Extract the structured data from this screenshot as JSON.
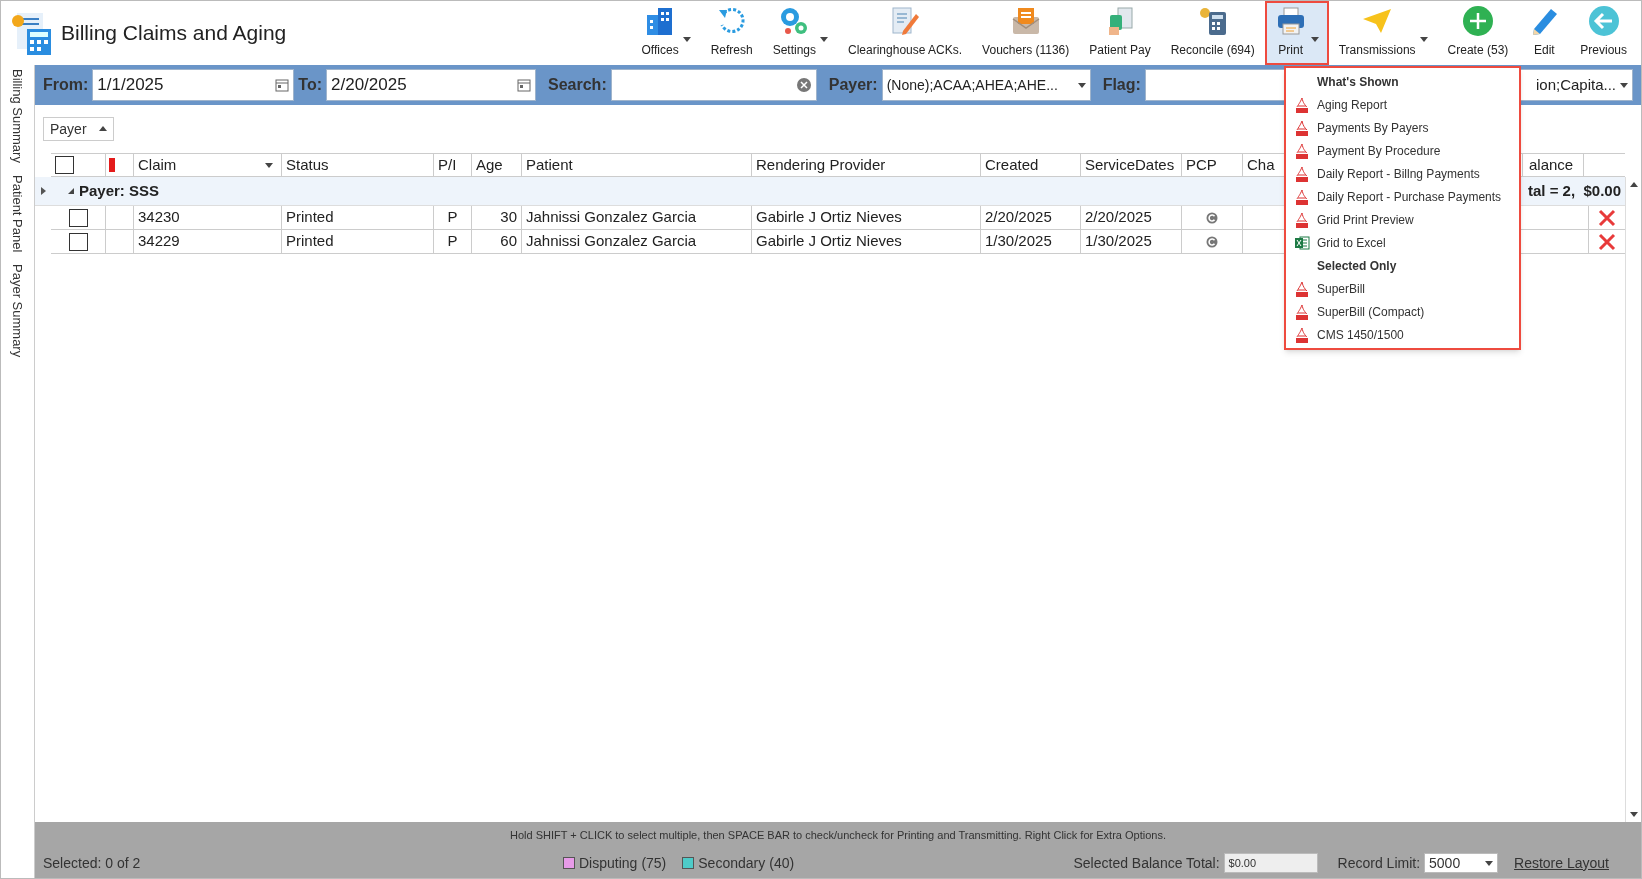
{
  "window": {
    "title": "Billing Claims and Aging"
  },
  "toolbar": [
    {
      "kind": "offices",
      "label": "Offices",
      "dropdown": true,
      "selected": false
    },
    {
      "kind": "refresh",
      "label": "Refresh",
      "dropdown": false,
      "selected": false
    },
    {
      "kind": "settings",
      "label": "Settings",
      "dropdown": true,
      "selected": false
    },
    {
      "kind": "acks",
      "label": "Clearinghouse ACKs.",
      "dropdown": false,
      "selected": false
    },
    {
      "kind": "vouchers",
      "label": "Vouchers (1136)",
      "dropdown": false,
      "selected": false
    },
    {
      "kind": "patientpay",
      "label": "Patient Pay",
      "dropdown": false,
      "selected": false
    },
    {
      "kind": "reconcile",
      "label": "Reconcile (694)",
      "dropdown": false,
      "selected": false
    },
    {
      "kind": "print",
      "label": "Print",
      "dropdown": true,
      "selected": true
    },
    {
      "kind": "send",
      "label": "Transmissions",
      "dropdown": true,
      "selected": false
    },
    {
      "kind": "create",
      "label": "Create (53)",
      "dropdown": false,
      "selected": false
    },
    {
      "kind": "edit",
      "label": "Edit",
      "dropdown": false,
      "selected": false
    },
    {
      "kind": "previous",
      "label": "Previous",
      "dropdown": false,
      "selected": false
    }
  ],
  "side_tabs": [
    "Billing Summary",
    "Patient Panel",
    "Payer Summary"
  ],
  "filters": {
    "from": {
      "label": "From:",
      "value": "1/1/2025"
    },
    "to": {
      "label": "To:",
      "value": "2/20/2025"
    },
    "search": {
      "label": "Search:"
    },
    "payer": {
      "label": "Payer:",
      "value": "(None);ACAA;AHEA;AHE..."
    },
    "flag": {
      "label": "Flag:"
    },
    "field_3": {
      "value": "ion;Capita..."
    }
  },
  "group_by": {
    "label": "Payer"
  },
  "table": {
    "columns": [
      "Claim",
      "Status",
      "P/I",
      "Age",
      "Patient",
      "Rendering Provider",
      "Created",
      "ServiceDates",
      "PCP",
      "Cha",
      "alance"
    ],
    "select_all": {
      "checked": false
    },
    "group": {
      "label": "Payer: SSS",
      "summary": "tal = 2,  $0.00",
      "expanded": true
    },
    "rows": [
      {
        "checked": false,
        "claim": "34230",
        "status": "Printed",
        "pi": "P",
        "age": "30",
        "patient": "Jahnissi Gonzalez Garcia",
        "provider": "Gabirle J Ortiz Nieves",
        "created": "2/20/2025",
        "service_dates": "2/20/2025"
      },
      {
        "checked": false,
        "claim": "34229",
        "status": "Printed",
        "pi": "P",
        "age": "60",
        "patient": "Jahnissi Gonzalez Garcia",
        "provider": "Gabirle J Ortiz Nieves",
        "created": "1/30/2025",
        "service_dates": "1/30/2025"
      }
    ]
  },
  "print_menu": [
    {
      "kind": "header",
      "label": "What's Shown"
    },
    {
      "kind": "pdf",
      "label": "Aging Report"
    },
    {
      "kind": "pdf",
      "label": "Payments By Payers"
    },
    {
      "kind": "pdf",
      "label": "Payment By Procedure"
    },
    {
      "kind": "pdf",
      "label": "Daily Report - Billng Payments"
    },
    {
      "kind": "pdf",
      "label": "Daily Report - Purchase Payments"
    },
    {
      "kind": "pdf",
      "label": "Grid Print Preview"
    },
    {
      "kind": "excel",
      "label": "Grid to Excel"
    },
    {
      "kind": "header",
      "label": "Selected Only"
    },
    {
      "kind": "pdf",
      "label": "SuperBill"
    },
    {
      "kind": "pdf",
      "label": "SuperBill (Compact)"
    },
    {
      "kind": "pdf",
      "label": "CMS 1450/1500"
    }
  ],
  "status_bar": {
    "hint": "Hold SHIFT + CLICK to select multiple, then SPACE BAR to check/uncheck for Printing and Transmitting. Right Click for Extra Options.",
    "selected": "Selected: 0 of 2",
    "legend": [
      {
        "label": "Disputing",
        "count": "(75)",
        "color": "#e79be8"
      },
      {
        "label": "Secondary",
        "count": "(40)",
        "color": "#4ecbc8"
      }
    ],
    "balance": {
      "label": "Selected Balance Total:",
      "value": "$0.00"
    },
    "record_limit": {
      "label": "Record Limit:",
      "value": "5000"
    },
    "restore": "Restore Layout"
  }
}
